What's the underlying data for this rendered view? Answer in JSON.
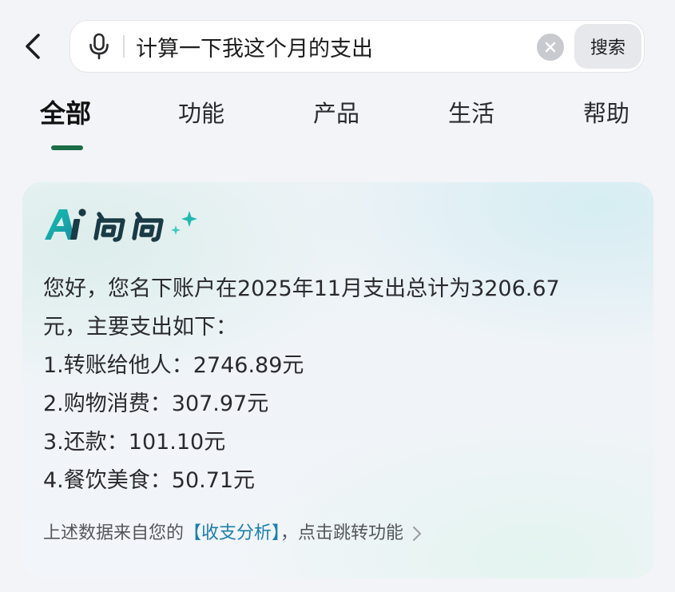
{
  "search": {
    "query": "计算一下我这个月的支出",
    "button_label": "搜索"
  },
  "tabs": [
    {
      "label": "全部",
      "active": true
    },
    {
      "label": "功能",
      "active": false
    },
    {
      "label": "产品",
      "active": false
    },
    {
      "label": "生活",
      "active": false
    },
    {
      "label": "帮助",
      "active": false
    }
  ],
  "ai_card": {
    "logo_text": "Ai问问",
    "logo_colors": {
      "teal": "#1bb5a6",
      "dark": "#16333f"
    },
    "lines": [
      "您好，您名下账户在2025年11月支出总计为3206.67",
      "元，主要支出如下：",
      "1.转账给他人：2746.89元",
      "2.购物消费：307.97元",
      "3.还款：101.10元",
      "4.餐饮美食：50.71元"
    ],
    "footer": {
      "prefix": "上述数据来自您的",
      "link": "【收支分析】",
      "suffix": "，点击跳转功能"
    }
  },
  "colors": {
    "accent": "#1b6e47",
    "link": "#1d7fae",
    "background": "#f3f4f8"
  },
  "icons": [
    "back-icon",
    "microphone-icon",
    "clear-icon",
    "sparkle-icon",
    "chevron-right-icon"
  ]
}
